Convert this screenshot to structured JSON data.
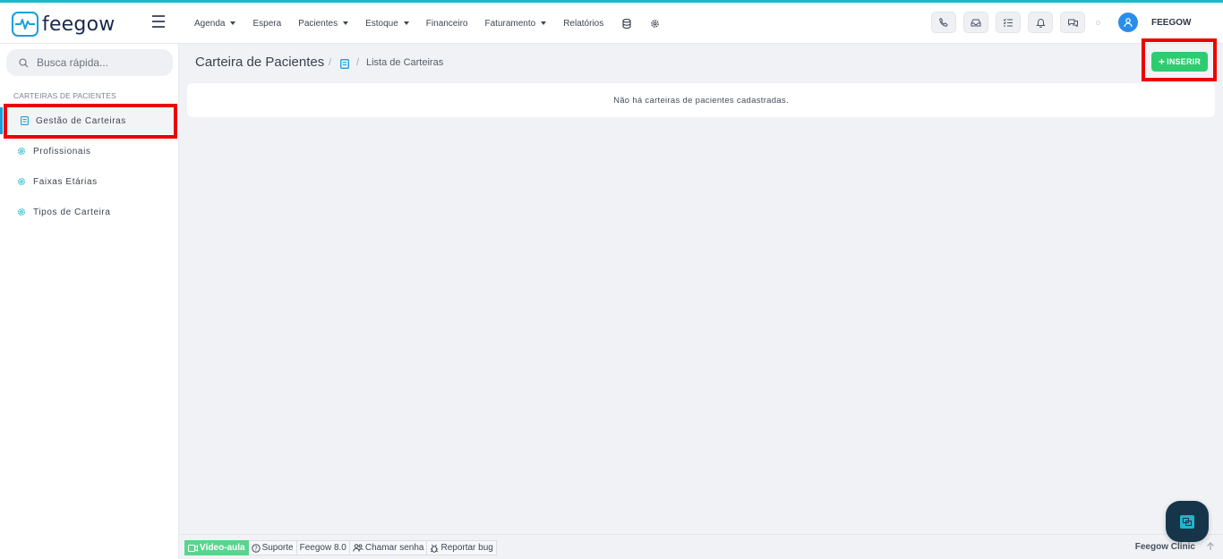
{
  "app": {
    "brand": "feegow",
    "accent_color": "#1fb6c9",
    "primary_blue": "#1a9fd8"
  },
  "header": {
    "menu_icon": "hamburger-icon",
    "nav": [
      {
        "label": "Agenda",
        "dropdown": true
      },
      {
        "label": "Espera",
        "dropdown": false
      },
      {
        "label": "Pacientes",
        "dropdown": true
      },
      {
        "label": "Estoque",
        "dropdown": true
      },
      {
        "label": "Financeiro",
        "dropdown": false
      },
      {
        "label": "Faturamento",
        "dropdown": true
      },
      {
        "label": "Relatórios",
        "dropdown": false
      }
    ],
    "nav_icons": [
      "database-icon",
      "settings-icon"
    ],
    "toolbar_icons": [
      "phone-icon",
      "inbox-icon",
      "checklist-icon",
      "bell-icon",
      "chat-icon"
    ],
    "user": {
      "name": "FEEGOW",
      "avatar_icon": "user-icon"
    }
  },
  "sidebar": {
    "search_placeholder": "Busca rápida...",
    "section_title": "CARTEIRAS DE PACIENTES",
    "items": [
      {
        "label": "Gestão de Carteiras",
        "icon": "list-icon",
        "active": true
      },
      {
        "label": "Profissionais",
        "icon": "gear-icon",
        "active": false
      },
      {
        "label": "Faixas Etárias",
        "icon": "gear-icon",
        "active": false
      },
      {
        "label": "Tipos de Carteira",
        "icon": "gear-icon",
        "active": false
      }
    ]
  },
  "breadcrumb": {
    "title": "Carteira de Pacientes",
    "separator": "/",
    "current": "Lista de Carteiras",
    "insert_label": "INSERIR",
    "insert_color": "#2ecc71"
  },
  "main": {
    "empty_message": "Não há carteiras de pacientes cadastradas."
  },
  "highlight_color": "#ee0000",
  "footer": {
    "items": [
      {
        "label": "Vídeo-aula",
        "icon": "video-icon"
      },
      {
        "label": "Suporte",
        "icon": "help-icon"
      },
      {
        "label": "Feegow 8.0",
        "icon": ""
      },
      {
        "label": "Chamar senha",
        "icon": "people-icon"
      },
      {
        "label": "Reportar bug",
        "icon": "bug-icon"
      }
    ],
    "right_label": "Feegow Clinic"
  }
}
